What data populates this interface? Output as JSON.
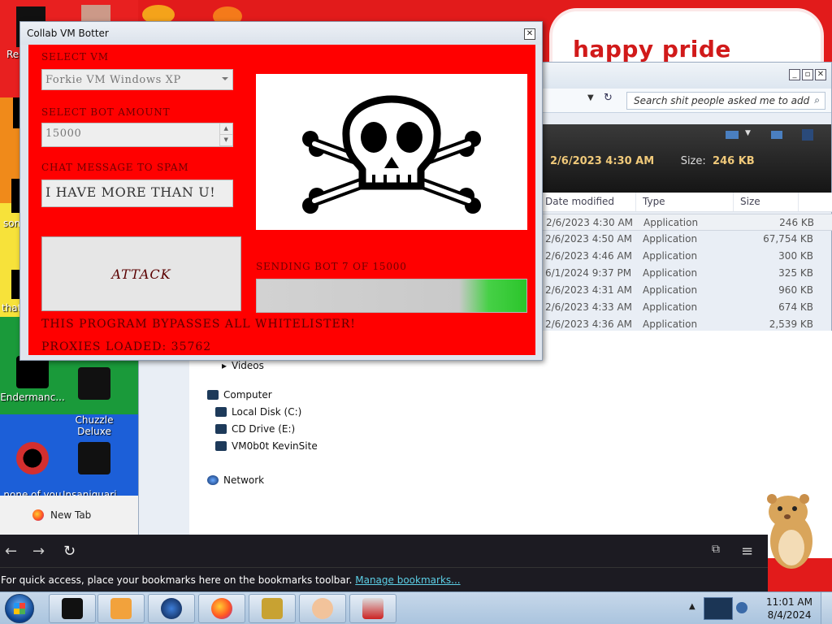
{
  "desktop": {
    "banner_text": "happy pride month",
    "icons": [
      {
        "label": "Endermanc..."
      },
      {
        "label": "Chuzzle\nDeluxe"
      },
      {
        "label": "none of you\nretards kno..."
      },
      {
        "label": "Insaniquari...\nDeluxe"
      }
    ],
    "partial_labels": [
      "Re",
      "some",
      "that"
    ]
  },
  "explorer": {
    "search_placeholder": "Search shit people asked me to add",
    "details": {
      "date": "2/6/2023 4:30 AM",
      "size_label": "Size:",
      "size_value": "246 KB"
    },
    "columns": [
      "Date modified",
      "Type",
      "Size"
    ],
    "rows": [
      {
        "date": "2/6/2023 4:30 AM",
        "type": "Application",
        "size": "246 KB"
      },
      {
        "date": "2/6/2023 4:50 AM",
        "type": "Application",
        "size": "67,754 KB"
      },
      {
        "date": "2/6/2023 4:46 AM",
        "type": "Application",
        "size": "300 KB"
      },
      {
        "date": "6/1/2024 9:37 PM",
        "type": "Application",
        "size": "325 KB"
      },
      {
        "date": "2/6/2023 4:31 AM",
        "type": "Application",
        "size": "960 KB"
      },
      {
        "date": "2/6/2023 4:33 AM",
        "type": "Application",
        "size": "674 KB"
      },
      {
        "date": "2/6/2023 4:36 AM",
        "type": "Application",
        "size": "2,539 KB"
      }
    ],
    "nav": {
      "videos": "Videos",
      "computer": "Computer",
      "local_disk": "Local Disk (C:)",
      "cd_drive": "CD Drive (E:)",
      "share": "VM0b0t KevinSite",
      "network": "Network"
    }
  },
  "browser": {
    "tab_label": "New Tab",
    "bookmarks_text": "For quick access, place your bookmarks here on the bookmarks toolbar.",
    "bookmarks_link": "Manage bookmarks..."
  },
  "botter": {
    "title": "Collab VM Botter",
    "select_vm_label": "SELECT VM",
    "select_vm_value": "Forkie VM Windows XP",
    "bot_amount_label": "SELECT BOT AMOUNT",
    "bot_amount_value": "15000",
    "chat_label": "CHAT MESSAGE TO SPAM",
    "chat_value": "I HAVE MORE THAN U!",
    "attack_label": "ATTACK",
    "sending_text": "SENDING BOT 7 OF 15000",
    "progress_fraction": 0.1,
    "bypass_text": "THIS PROGRAM BYPASSES ALL WHITELISTER!",
    "proxies_text": "PROXIES LOADED: 35762"
  },
  "taskbar": {
    "time": "11:01 AM",
    "date": "8/4/2024"
  }
}
